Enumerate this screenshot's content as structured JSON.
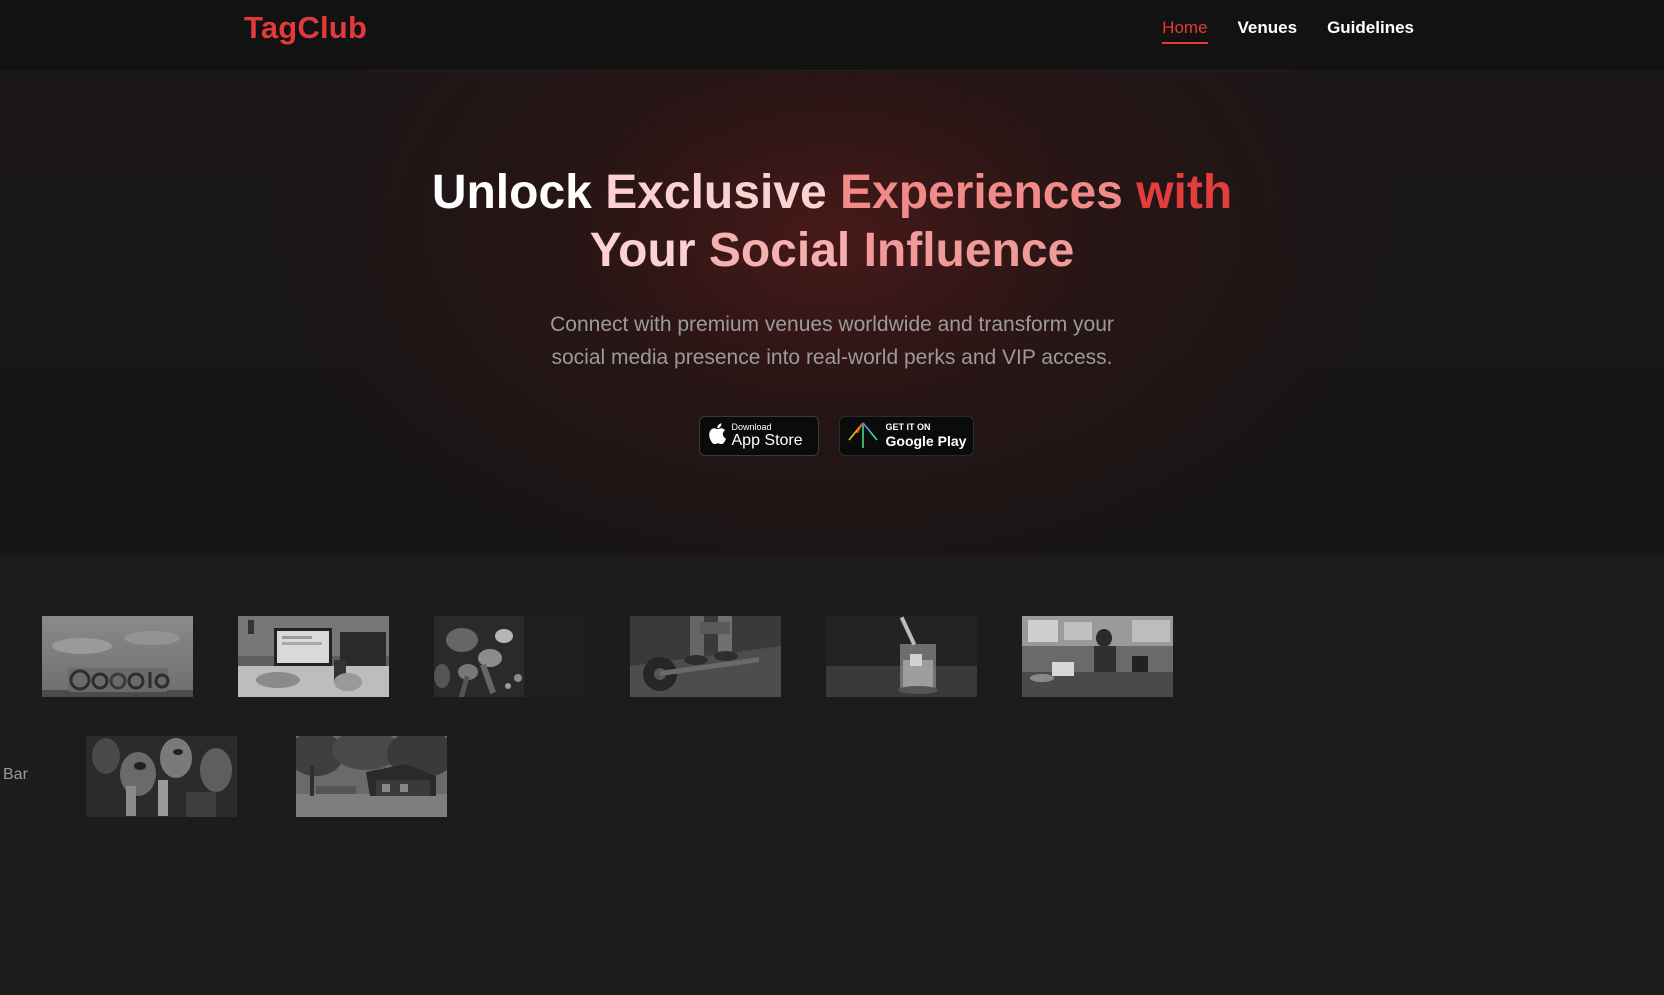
{
  "brand": {
    "name": "TagClub",
    "accent": "#e23a3a"
  },
  "nav": {
    "links": [
      {
        "label": "Home",
        "active": true
      },
      {
        "label": "Venues",
        "active": false
      },
      {
        "label": "Guidelines",
        "active": false
      }
    ]
  },
  "hero": {
    "title_parts": [
      "Unlock ",
      "Exclusive ",
      "Experiences ",
      "with",
      "Your ",
      "Social ",
      "Influence"
    ],
    "subtitle_line1": "Connect with premium venues worldwide and transform your",
    "subtitle_line2": "social media presence into real-world perks and VIP access."
  },
  "store": {
    "apple_small": "Download",
    "apple_big": "App Store",
    "google_small": "GET IT ON",
    "google_big": "Google Play"
  },
  "venues": {
    "side_label": "Bar",
    "thumbnails": [
      {
        "name": "google-sign"
      },
      {
        "name": "office-desk"
      },
      {
        "name": "food-spoons"
      },
      {
        "name": "gym-weights"
      },
      {
        "name": "drink-glass"
      },
      {
        "name": "cafe-interior"
      },
      {
        "name": "bar-crowd"
      },
      {
        "name": "forest-cabin"
      }
    ]
  }
}
